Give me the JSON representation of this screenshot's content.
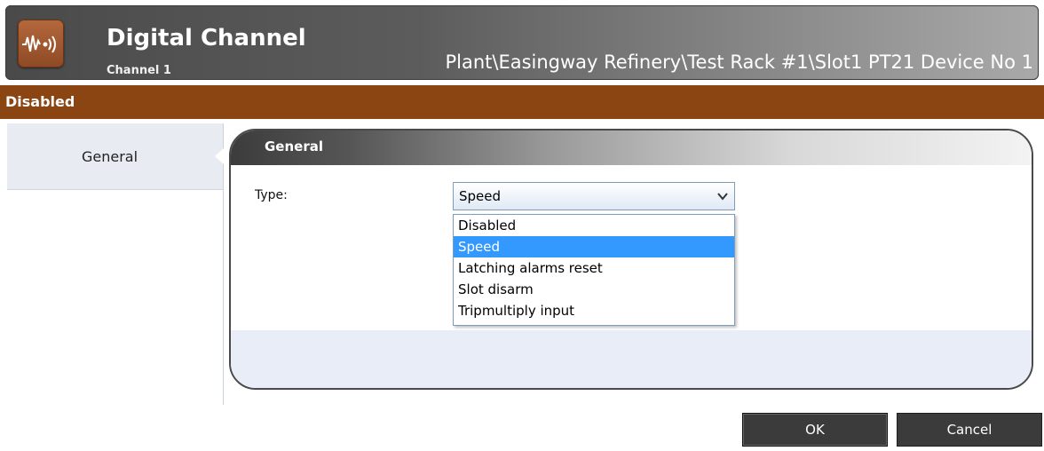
{
  "header": {
    "title": "Digital Channel",
    "subtitle": "Channel 1",
    "path": "Plant\\Easingway Refinery\\Test Rack #1\\Slot1 PT21 Device No 1",
    "icon": "waveform-broadcast-icon"
  },
  "status": {
    "text": "Disabled",
    "color": "#8b4513"
  },
  "sidebar": {
    "items": [
      {
        "label": "General"
      }
    ]
  },
  "panel": {
    "title": "General"
  },
  "form": {
    "type_label": "Type:",
    "type_value": "Speed",
    "options": [
      "Disabled",
      "Speed",
      "Latching alarms reset",
      "Slot disarm",
      "Tripmultiply input"
    ],
    "selected_index": 1
  },
  "buttons": {
    "ok": "OK",
    "cancel": "Cancel"
  }
}
